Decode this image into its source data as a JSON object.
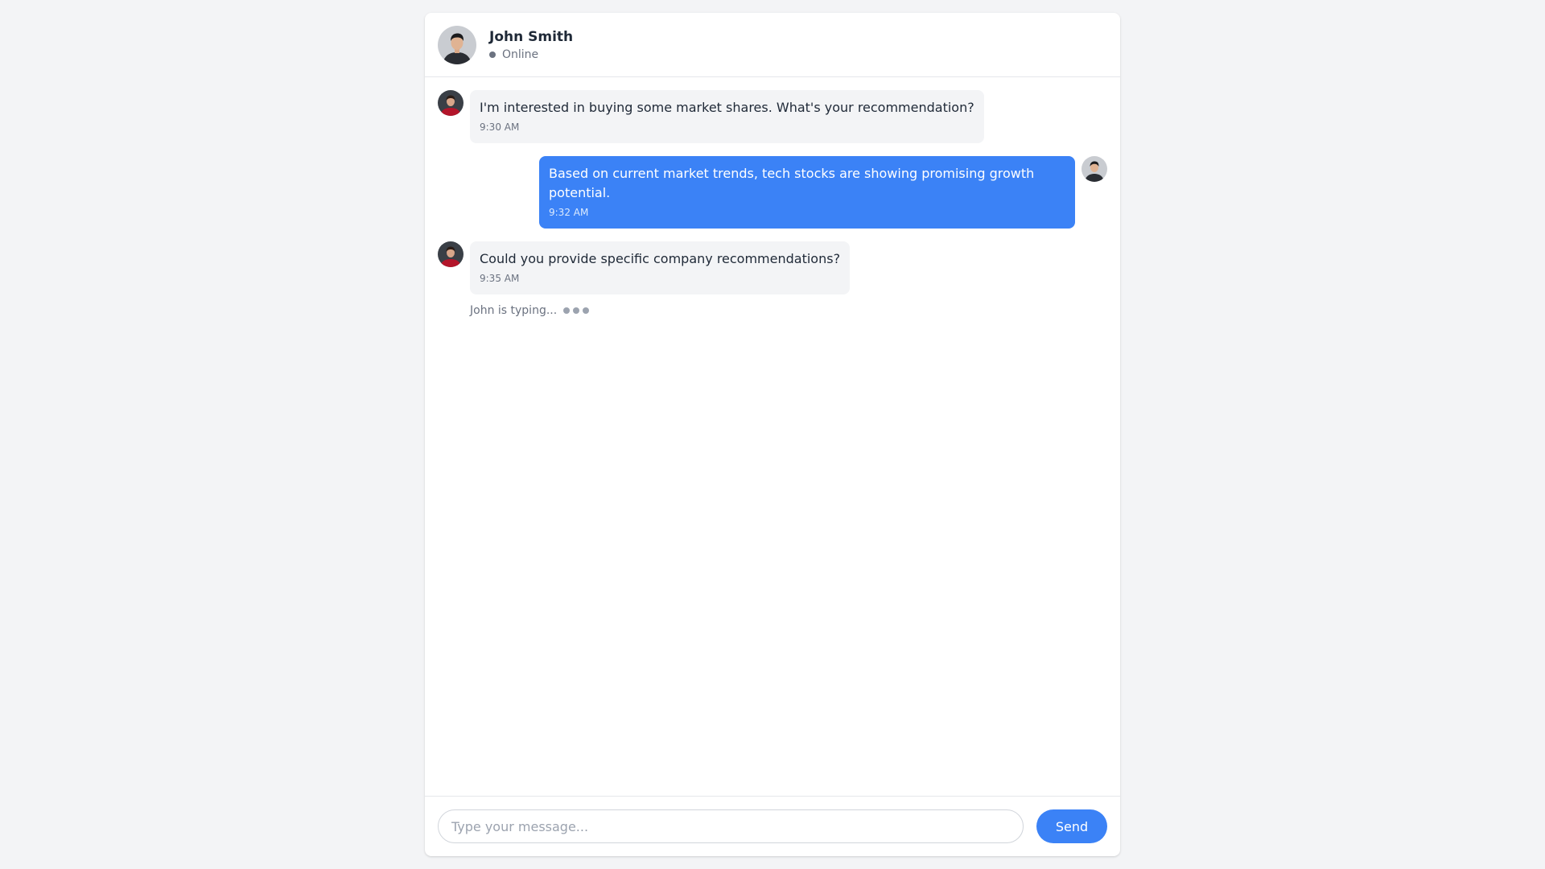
{
  "header": {
    "contact_name": "John Smith",
    "status": "Online",
    "avatar_icon": "john-smith-avatar"
  },
  "messages": [
    {
      "direction": "incoming",
      "text": "I'm interested in buying some market shares. What's your recommendation?",
      "time": "9:30 AM",
      "avatar_icon": "red-shirt-user-avatar"
    },
    {
      "direction": "outgoing",
      "text": "Based on current market trends, tech stocks are showing promising growth potential.",
      "time": "9:32 AM",
      "avatar_icon": "john-smith-avatar"
    },
    {
      "direction": "incoming",
      "text": "Could you provide specific company recommendations?",
      "time": "9:35 AM",
      "avatar_icon": "red-shirt-user-avatar"
    }
  ],
  "typing_indicator": {
    "text": "John is typing..."
  },
  "composer": {
    "placeholder": "Type your message...",
    "value": "",
    "send_label": "Send"
  },
  "colors": {
    "accent": "#3b82f6",
    "incoming_bubble": "#f3f4f6",
    "page_background": "#f3f4f6"
  }
}
